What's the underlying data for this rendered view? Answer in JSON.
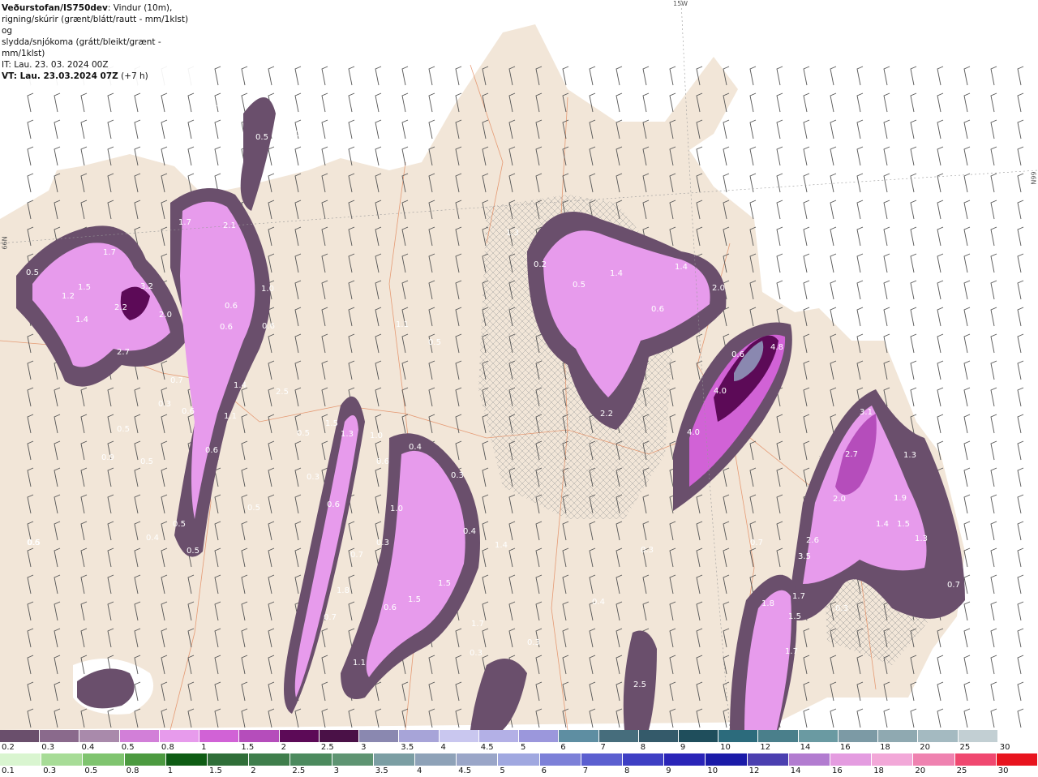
{
  "header": {
    "title": "Veðurstofan/IS750dev",
    "line1_rest": ": Vindur (10m),",
    "line2": "rigning/skúrir (grænt/blátt/rautt - mm/1klst) og",
    "line3": "slydda/snjókoma (grátt/bleikt/grænt - mm/1klst)",
    "line4": "IT: Lau. 23. 03. 2024 00Z",
    "line5": "VT: Lau. 23.03.2024 07Z",
    "line5_rest": " (+7 h)"
  },
  "graticule": {
    "lon_label": "15W",
    "lat_label_right": "66N",
    "lat_label_left": "66N"
  },
  "map_values": [
    "0.7",
    "0.5",
    "0.5",
    "0.2",
    "1.7",
    "2.1",
    "1.7",
    "0.5",
    "1.5",
    "1.2",
    "3.2",
    "2.2",
    "2.0",
    "1.4",
    "2.7",
    "0.6",
    "0.6",
    "1.0",
    "0.6",
    "1.4",
    "1.1",
    "2.5",
    "0.7",
    "0.3",
    "0.6",
    "0.5",
    "0.9",
    "0.5",
    "0.6",
    "0.5",
    "0.4",
    "0.5",
    "0.5",
    "1.3",
    "0.2",
    "0.5",
    "1.4",
    "1.4",
    "2.0",
    "0.6",
    "1.1",
    "0.5",
    "0.6",
    "4.8",
    "4.0",
    "4.0",
    "2.2",
    "0.4",
    "1.0",
    "0.4",
    "1.4",
    "0.7",
    "0.6",
    "1.3",
    "1.8",
    "0.7",
    "0.6",
    "1.5",
    "1.5",
    "1.7",
    "0.3",
    "0.3",
    "0.4",
    "0.3",
    "1.1",
    "2.5",
    "3.1",
    "2.7",
    "1.3",
    "2.0",
    "1.9",
    "1.4",
    "1.5",
    "1.3",
    "2.6",
    "3.5",
    "1.7",
    "1.5",
    "1.7",
    "1.8",
    "0.3",
    "0.5",
    "0.7",
    "0.5",
    "1.5",
    "0.6",
    "0.3",
    "1.0",
    "0.6",
    "0.3",
    "0.3",
    "0.7"
  ],
  "legend_snow": {
    "labels": [
      "0.2",
      "0.3",
      "0.4",
      "0.5",
      "0.8",
      "1",
      "1.5",
      "2",
      "2.5",
      "3",
      "3.5",
      "4",
      "4.5",
      "5",
      "6",
      "7",
      "8",
      "9",
      "10",
      "12",
      "14",
      "16",
      "18",
      "20",
      "25",
      "30"
    ],
    "colors": [
      "#6a4f6c",
      "#8a6a8c",
      "#a98aab",
      "#d27fd8",
      "#e79bec",
      "#d162d6",
      "#b54dbb",
      "#5c0a57",
      "#4a1147",
      "#8a88b0",
      "#a7a4d8",
      "#c9c7ef",
      "#b3b0e6",
      "#9b97dc",
      "#5e8ea2",
      "#466d7c",
      "#345a6a",
      "#1f4e5c",
      "#2c6b7c",
      "#4a7f8b",
      "#6a9aa2",
      "#7c9aa5",
      "#8fa9b1",
      "#a4bac1",
      "#c2cfd3",
      "#ffffff"
    ]
  },
  "legend_rain": {
    "labels": [
      "0.1",
      "0.3",
      "0.5",
      "0.8",
      "1",
      "1.5",
      "2",
      "2.5",
      "3",
      "3.5",
      "4",
      "4.5",
      "5",
      "6",
      "7",
      "8",
      "9",
      "10",
      "12",
      "14",
      "16",
      "18",
      "20",
      "25",
      "30"
    ],
    "colors": [
      "#d9f5d0",
      "#a7dc97",
      "#7fc46f",
      "#4c9a40",
      "#0e5c14",
      "#2f6e38",
      "#3f7e4c",
      "#4c8a5e",
      "#5e9472",
      "#7b9ea3",
      "#8ea2b8",
      "#9aa6c8",
      "#a0a8e0",
      "#7c80d8",
      "#5b5fd0",
      "#3e3fc4",
      "#2a24b8",
      "#1a1aa8",
      "#4b3fb0",
      "#b27cd0",
      "#e49ce0",
      "#f2a8d8",
      "#ef82b0",
      "#f04870",
      "#e8141e"
    ]
  },
  "colors": {
    "land": "#f2e6d8",
    "sea": "#ffffff",
    "roads": "#e07a4a",
    "wind_barb": "#555555"
  }
}
